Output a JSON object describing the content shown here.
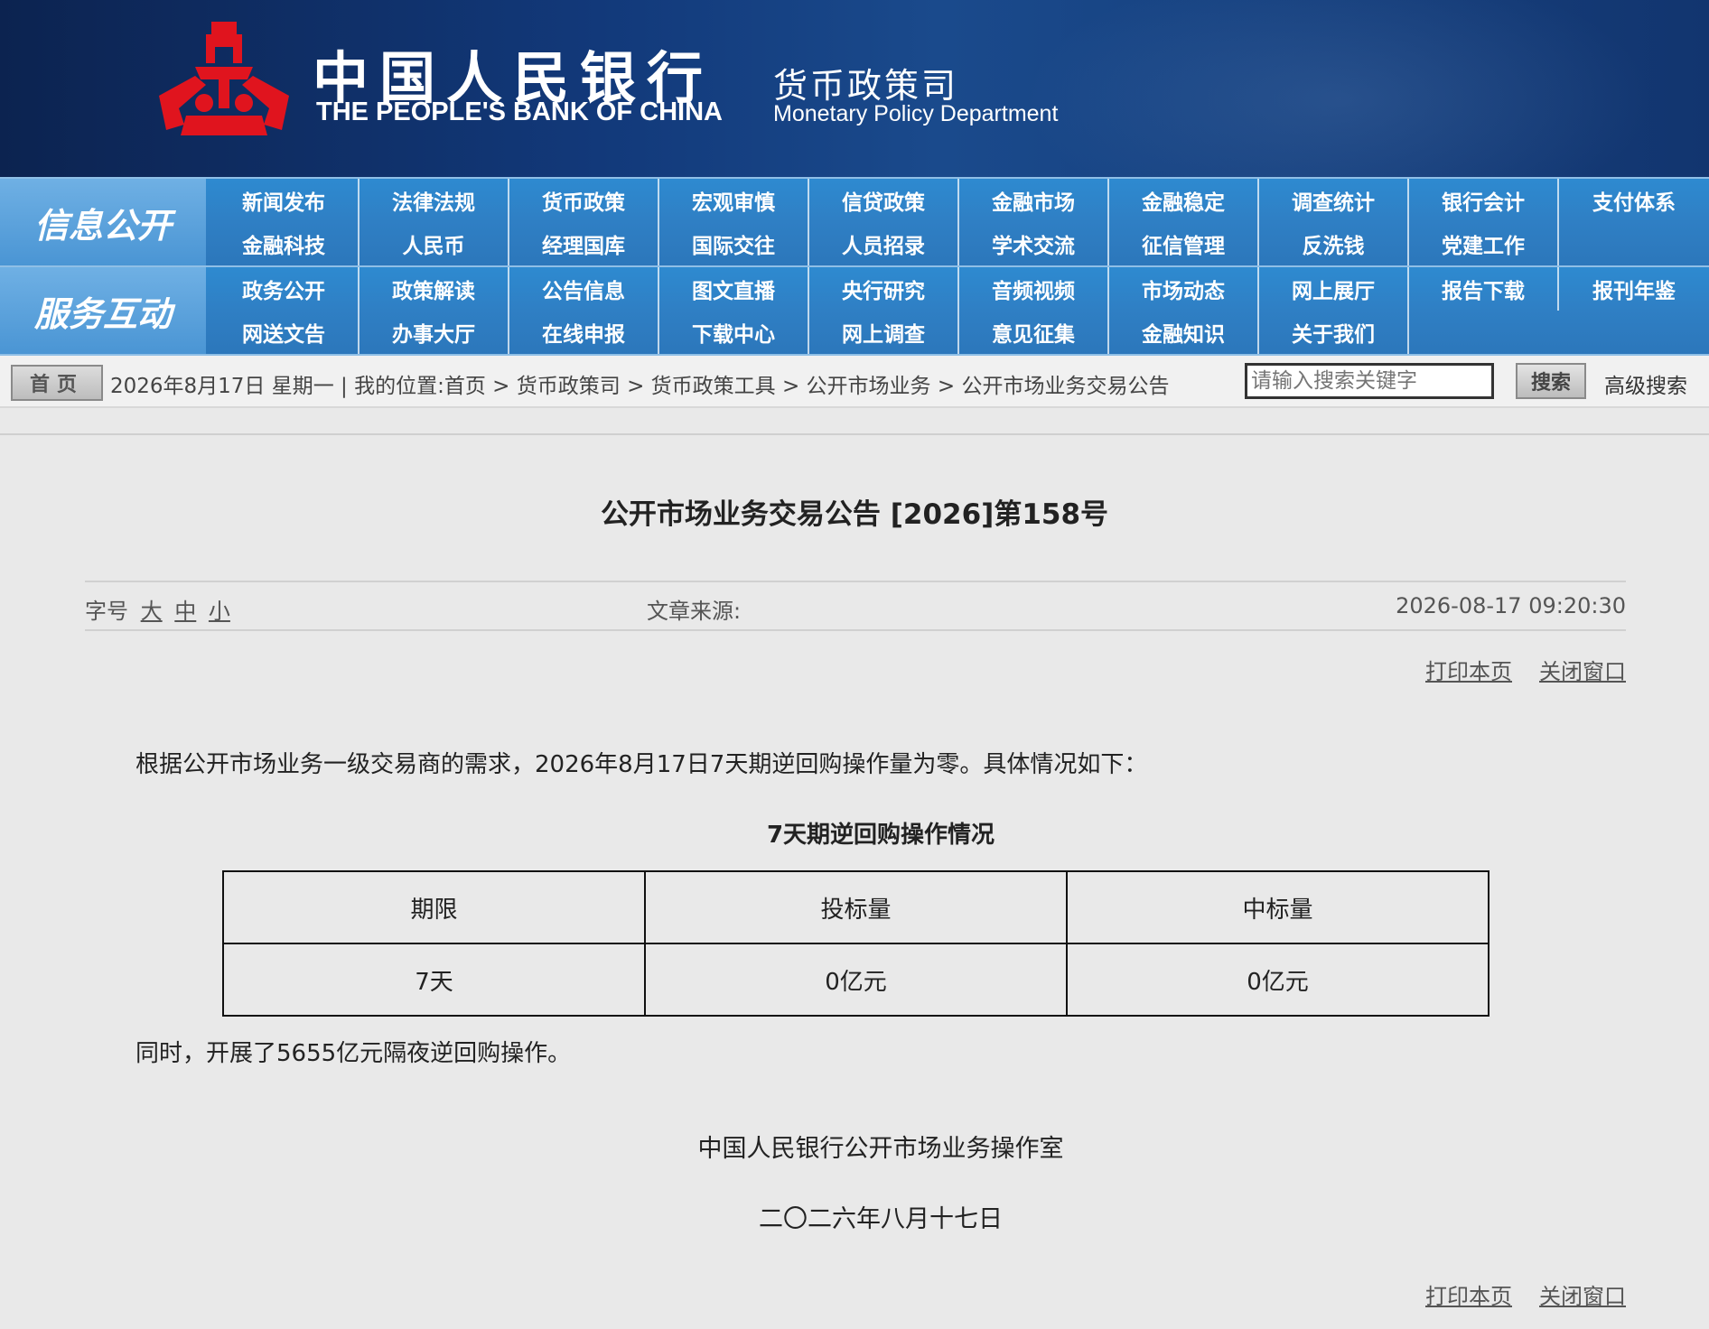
{
  "header": {
    "bank_name_cn": "中国人民银行",
    "bank_name_en": "THE PEOPLE'S BANK OF CHINA",
    "department_cn": "货币政策司",
    "department_en": "Monetary Policy Department",
    "logo_icon": "pboc-emblem-icon",
    "logo_color": "#e0141e"
  },
  "nav": {
    "row1_label": "信息公开",
    "row1_items": [
      "新闻发布",
      "法律法规",
      "货币政策",
      "宏观审慎",
      "信贷政策",
      "金融市场",
      "金融稳定",
      "调查统计",
      "银行会计",
      "支付体系",
      "金融科技",
      "人民币",
      "经理国库",
      "国际交往",
      "人员招录",
      "学术交流",
      "征信管理",
      "反洗钱",
      "党建工作"
    ],
    "row2_label": "服务互动",
    "row2_items": [
      "政务公开",
      "政策解读",
      "公告信息",
      "图文直播",
      "央行研究",
      "音频视频",
      "市场动态",
      "网上展厅",
      "报告下载",
      "报刊年鉴",
      "网送文告",
      "办事大厅",
      "在线申报",
      "下载中心",
      "网上调查",
      "意见征集",
      "金融知识",
      "关于我们"
    ]
  },
  "breadcrumb": {
    "home_label": "首页",
    "text": "2026年8月17日 星期一 | 我的位置:首页 > 货币政策司 > 货币政策工具 > 公开市场业务 > 公开市场业务交易公告",
    "search_placeholder": "请输入搜索关键字",
    "search_button": "搜索",
    "advanced_search": "高级搜索"
  },
  "article": {
    "title": "公开市场业务交易公告 [2026]第158号",
    "font_size_label": "字号",
    "font_size_large": "大",
    "font_size_medium": "中",
    "font_size_small": "小",
    "source_label": "文章来源:",
    "datetime": "2026-08-17 09:20:30",
    "print_label": "打印本页",
    "close_label": "关闭窗口",
    "intro": "根据公开市场业务一级交易商的需求，2026年8月17日7天期逆回购操作量为零。具体情况如下：",
    "table_title": "7天期逆回购操作情况",
    "table_headers": [
      "期限",
      "投标量",
      "中标量"
    ],
    "table_rows": [
      [
        "7天",
        "0亿元",
        "0亿元"
      ]
    ],
    "followup": "同时，开展了5655亿元隔夜逆回购操作。",
    "signature_org": "中国人民银行公开市场业务操作室",
    "signature_date": "二〇二六年八月十七日"
  }
}
